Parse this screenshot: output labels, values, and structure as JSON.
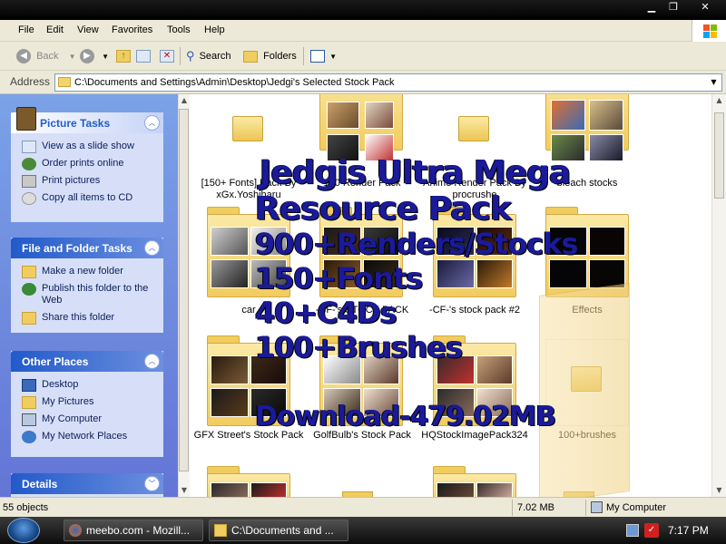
{
  "window": {
    "title_buttons": [
      "minimize",
      "restore",
      "close"
    ]
  },
  "menu": {
    "items": [
      "File",
      "Edit",
      "View",
      "Favorites",
      "Tools",
      "Help"
    ]
  },
  "toolbar": {
    "back_label": "Back",
    "search_label": "Search",
    "folders_label": "Folders"
  },
  "address": {
    "label": "Address",
    "path": "C:\\Documents and Settings\\Admin\\Desktop\\Jedgi's Selected Stock Pack"
  },
  "sidebar": {
    "picture_tasks": {
      "title": "Picture Tasks",
      "items": [
        "View as a slide show",
        "Order prints online",
        "Print pictures",
        "Copy all items to CD"
      ]
    },
    "file_folder_tasks": {
      "title": "File and Folder Tasks",
      "items": [
        "Make a new folder",
        "Publish this folder to the Web",
        "Share this folder"
      ]
    },
    "other_places": {
      "title": "Other Places",
      "items": [
        "Desktop",
        "My Pictures",
        "My Computer",
        "My Network Places"
      ]
    },
    "details": {
      "title": "Details"
    }
  },
  "folders": {
    "row1": [
      "[150+ Fonts] Pack By xGx.Yoshiharu",
      "150 Render Pack",
      "Anime Render Pack By procrushe",
      "bleach stocks"
    ],
    "row2": [
      "car",
      "-CF-'s STOCK PACK",
      "-CF-'s stock pack #2",
      "Effects"
    ],
    "row3": [
      "GFX Street's Stock Pack",
      "GolfBulb's Stock Pack",
      "HQStockImagePack324",
      "100+brushes"
    ]
  },
  "overlay": {
    "line1": "Jedgis Ultra Mega",
    "line2": "Resource Pack",
    "line3": "900+Renders/Stocks",
    "line4": "150+Fonts",
    "line5": "40+C4Ds",
    "line6": "100+Brushes",
    "line7": "Download-479.02MB"
  },
  "status": {
    "objects": "55 objects",
    "size": "7.02 MB",
    "zone": "My Computer"
  },
  "taskbar": {
    "buttons": [
      "meebo.com - Mozill...",
      "C:\\Documents and ..."
    ],
    "clock": "7:17 PM"
  },
  "colors": {
    "sidebar_gradient_top": "#7ba2e7",
    "sidebar_gradient_bottom": "#6375d6",
    "overlay_text": "#1a1a9a",
    "folder_yellow": "#f1cc5f"
  }
}
